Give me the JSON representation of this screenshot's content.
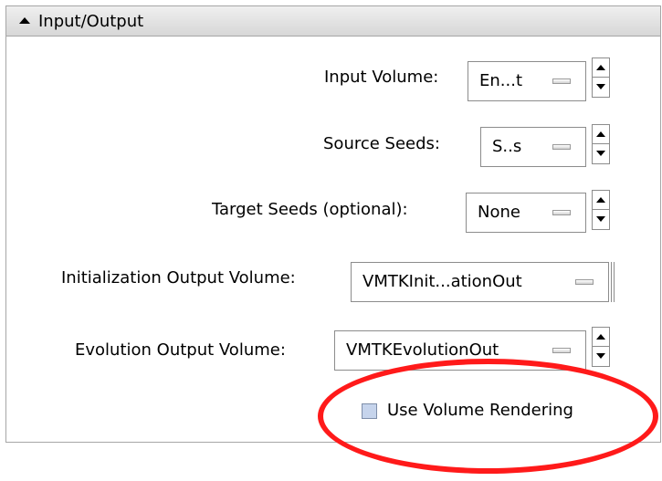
{
  "panel": {
    "title": "Input/Output",
    "collapse_icon": "triangle-up"
  },
  "fields": {
    "input_volume": {
      "label": "Input Volume:",
      "value": "En...t"
    },
    "source_seeds": {
      "label": "Source Seeds:",
      "value": "S..s"
    },
    "target_seeds": {
      "label": "Target Seeds (optional):",
      "value": "None"
    },
    "init_output": {
      "label": "Initialization Output Volume:",
      "value": "VMTKInit...ationOut"
    },
    "evolution_output": {
      "label": "Evolution Output Volume:",
      "value": "VMTKEvolutionOut"
    }
  },
  "options": {
    "use_volume_rendering": {
      "label": "Use Volume Rendering",
      "checked": false
    }
  },
  "colors": {
    "highlight": "#ff1a1a",
    "checkbox_fill": "#c6d4ec",
    "header_bg": "#e2e2e2"
  }
}
